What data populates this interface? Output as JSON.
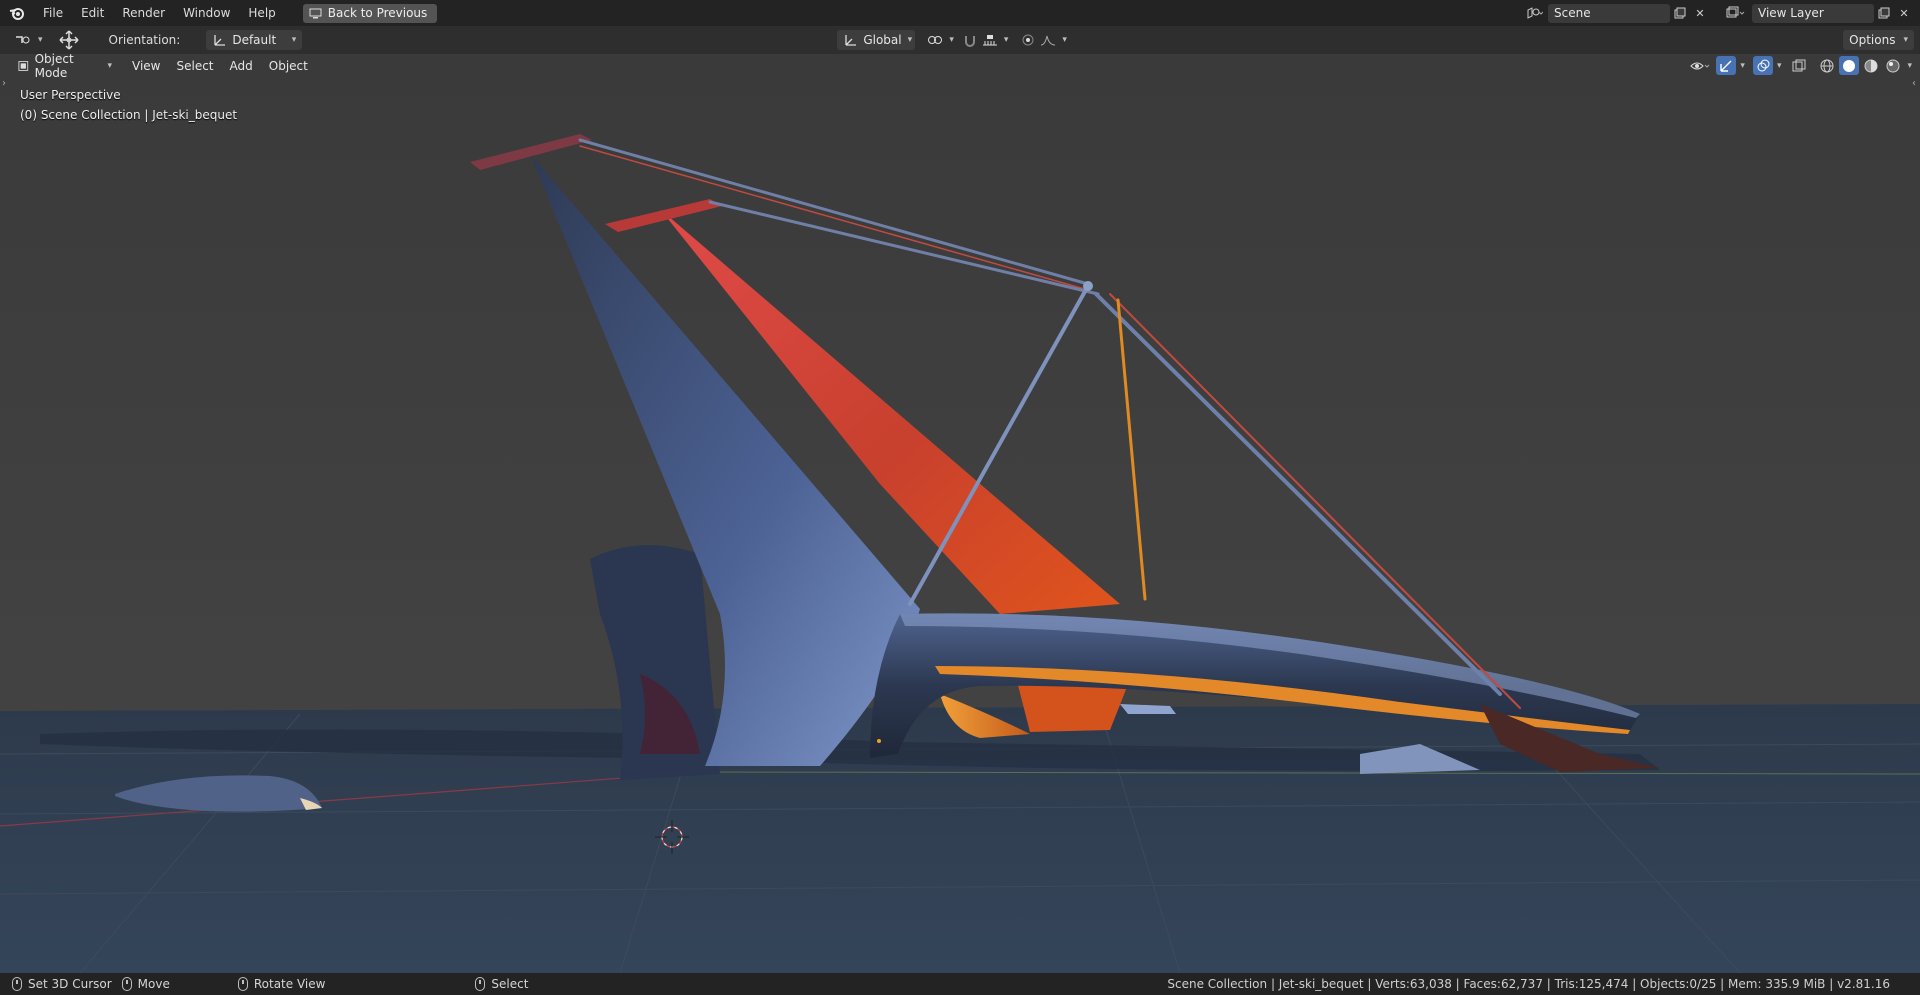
{
  "menubar": {
    "items": [
      "File",
      "Edit",
      "Render",
      "Window",
      "Help"
    ],
    "back_button": "Back to Previous",
    "scene_name": "Scene",
    "view_layer": "View Layer"
  },
  "toolheader": {
    "orientation_label": "Orientation:",
    "orientation_value": "Default",
    "transform_space": "Global",
    "options_label": "Options"
  },
  "viewport_header": {
    "mode": "Object Mode",
    "menus": [
      "View",
      "Select",
      "Add",
      "Object"
    ]
  },
  "viewport": {
    "perspective_label": "User Perspective",
    "collection_label": "(0) Scene Collection | Jet-ski_bequet"
  },
  "statusbar": {
    "set_cursor": "Set 3D Cursor",
    "move": "Move",
    "rotate": "Rotate View",
    "select": "Select",
    "stats": "Scene Collection | Jet-ski_bequet | Verts:63,038 | Faces:62,737 | Tris:125,474 | Objects:0/25 | Mem: 335.9 MiB | v2.81.16"
  },
  "colors": {
    "background_top": "#3f3f3f",
    "ground": "#2f3a48",
    "hull_blue": "#4f6a9a",
    "accent_red": "#d8463a",
    "accent_orange": "#e38a23"
  }
}
